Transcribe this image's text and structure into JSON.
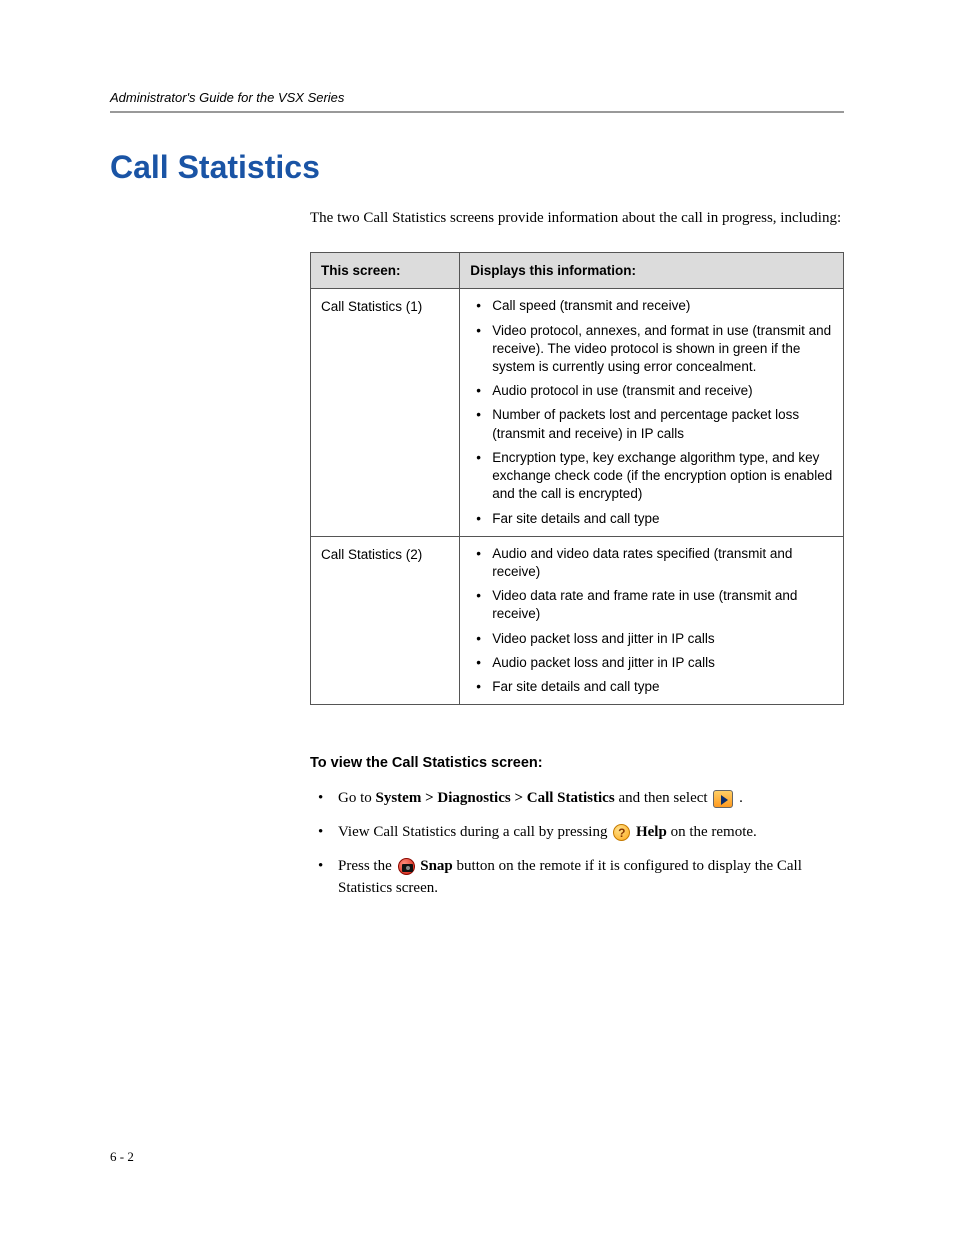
{
  "header": {
    "guide_title": "Administrator's Guide for the VSX Series"
  },
  "title": "Call Statistics",
  "intro": "The two Call Statistics screens provide information about the call in progress, including:",
  "table": {
    "headers": [
      "This screen:",
      "Displays this information:"
    ],
    "rows": [
      {
        "screen": "Call Statistics (1)",
        "items": [
          "Call speed (transmit and receive)",
          "Video protocol, annexes, and format in use (transmit and receive). The video protocol is shown in green if the system is currently using error concealment.",
          "Audio protocol in use (transmit and receive)",
          "Number of packets lost and percentage packet loss (transmit and receive) in IP calls",
          "Encryption type, key exchange algorithm type, and key exchange check code (if the encryption option is enabled and the call is encrypted)",
          "Far site details and call type"
        ]
      },
      {
        "screen": "Call Statistics (2)",
        "items": [
          "Audio and video data rates specified (transmit and receive)",
          "Video data rate and frame rate in use (transmit and receive)",
          "Video packet loss and jitter in IP calls",
          "Audio packet loss and jitter in IP calls",
          "Far site details and call type"
        ]
      }
    ]
  },
  "subhead": "To view the Call Statistics screen:",
  "steps": {
    "s1_prefix": "Go to ",
    "s1_bold": "System > Diagnostics > Call Statistics",
    "s1_mid": " and then select ",
    "s1_suffix": " .",
    "s2_prefix": "View Call Statistics during a call by pressing ",
    "s2_bold": "Help",
    "s2_suffix": " on the remote.",
    "s3_prefix": "Press the ",
    "s3_bold": "Snap",
    "s3_suffix": " button on the remote if it is configured to display the Call Statistics screen."
  },
  "page_number": "6 - 2"
}
